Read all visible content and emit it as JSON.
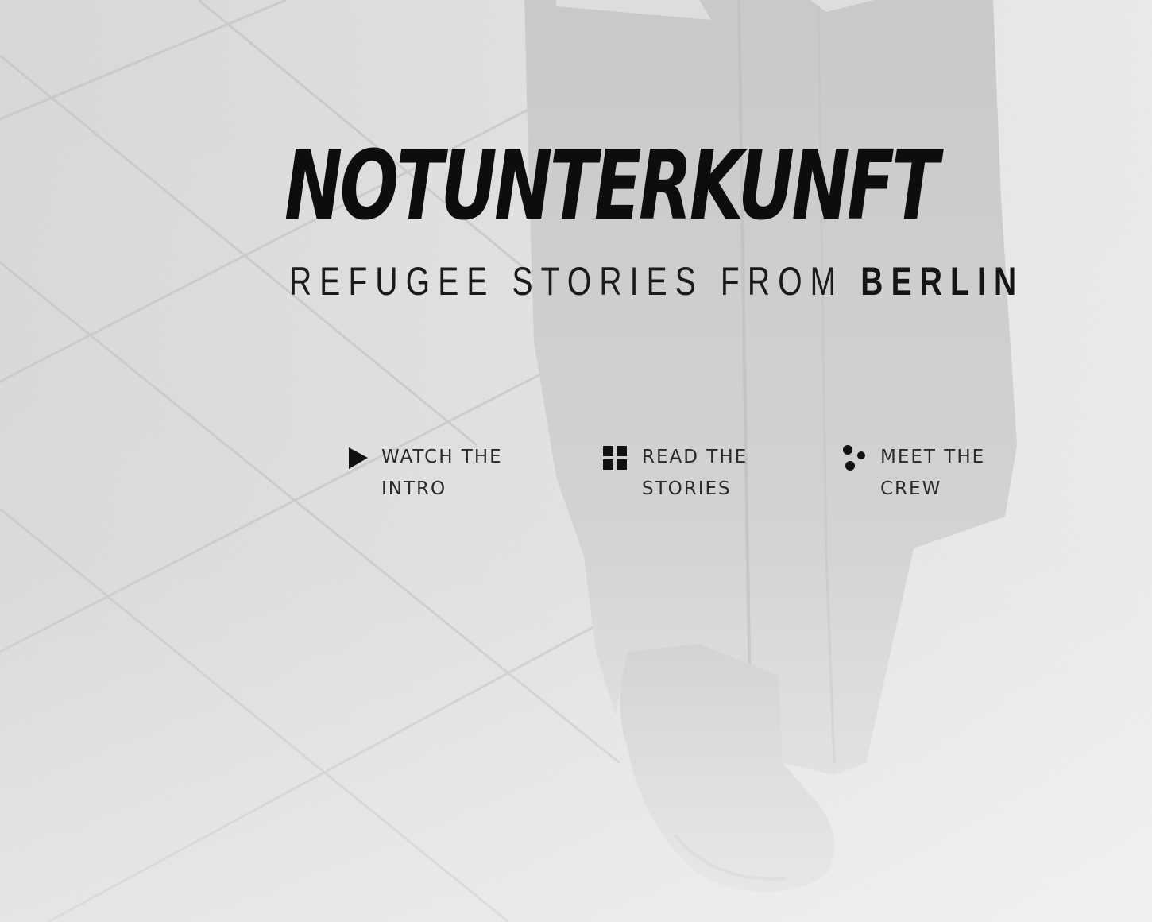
{
  "hero": {
    "title": "NOTUNTERKUNFT",
    "subtitle_prefix": "REFUGEE STORIES FROM ",
    "subtitle_city": "BERLIN"
  },
  "nav": {
    "watch": {
      "line1": "WATCH THE",
      "line2": "INTRO",
      "icon": "play-icon"
    },
    "read": {
      "line1": "READ THE",
      "line2": "STORIES",
      "icon": "grid-icon"
    },
    "crew": {
      "line1": "MEET THE",
      "line2": "CREW",
      "icon": "team-dots-icon"
    }
  },
  "colors": {
    "text": "#0d0d0d",
    "nav_text": "#2a2a2a",
    "background": "#e9e9e9"
  }
}
